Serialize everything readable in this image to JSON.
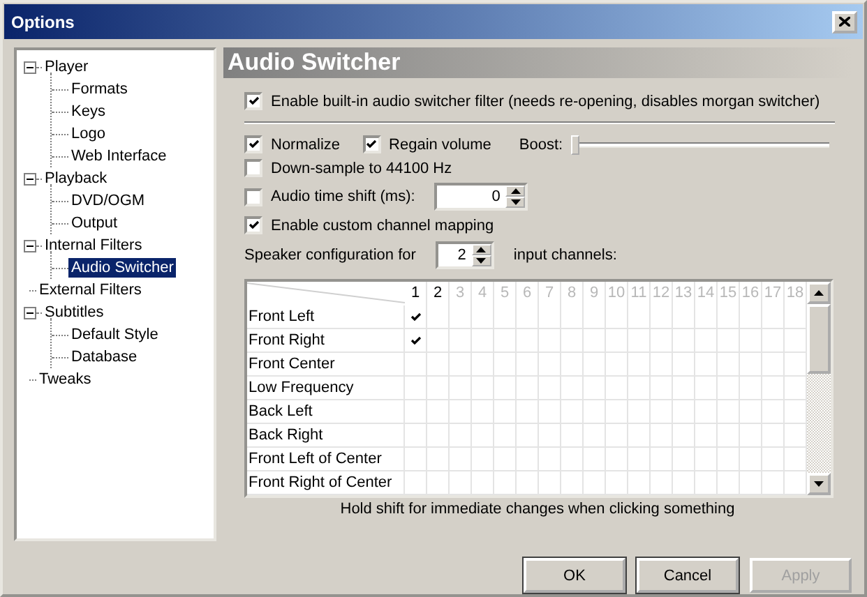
{
  "window": {
    "title": "Options"
  },
  "tree": [
    {
      "label": "Player",
      "expanded": true,
      "selected": false,
      "children": [
        {
          "label": "Formats",
          "selected": false
        },
        {
          "label": "Keys",
          "selected": false
        },
        {
          "label": "Logo",
          "selected": false
        },
        {
          "label": "Web Interface",
          "selected": false
        }
      ]
    },
    {
      "label": "Playback",
      "expanded": true,
      "selected": false,
      "children": [
        {
          "label": "DVD/OGM",
          "selected": false
        },
        {
          "label": "Output",
          "selected": false
        }
      ]
    },
    {
      "label": "Internal Filters",
      "expanded": true,
      "selected": false,
      "children": [
        {
          "label": "Audio Switcher",
          "selected": true
        }
      ]
    },
    {
      "label": "External Filters",
      "selected": false
    },
    {
      "label": "Subtitles",
      "expanded": true,
      "selected": false,
      "children": [
        {
          "label": "Default Style",
          "selected": false
        },
        {
          "label": "Database",
          "selected": false
        }
      ]
    },
    {
      "label": "Tweaks",
      "selected": false
    }
  ],
  "page": {
    "title": "Audio Switcher",
    "enable_filter": {
      "label": "Enable built-in audio switcher filter (needs re-opening, disables morgan switcher)",
      "checked": true
    },
    "normalize": {
      "label": "Normalize",
      "checked": true
    },
    "regain_volume": {
      "label": "Regain volume",
      "checked": true
    },
    "boost": {
      "label": "Boost:",
      "level": 0
    },
    "down_sample": {
      "label": "Down-sample to 44100 Hz",
      "checked": false
    },
    "time_shift": {
      "label": "Audio time shift (ms):",
      "checked": false,
      "value": "0"
    },
    "custom_mapping": {
      "label": "Enable custom channel mapping",
      "checked": true
    },
    "speaker_config": {
      "label_before": "Speaker configuration for",
      "value": "2",
      "label_after": "input channels:"
    },
    "grid": {
      "columns": [
        {
          "label": "1",
          "enabled": true
        },
        {
          "label": "2",
          "enabled": true
        },
        {
          "label": "3",
          "enabled": false
        },
        {
          "label": "4",
          "enabled": false
        },
        {
          "label": "5",
          "enabled": false
        },
        {
          "label": "6",
          "enabled": false
        },
        {
          "label": "7",
          "enabled": false
        },
        {
          "label": "8",
          "enabled": false
        },
        {
          "label": "9",
          "enabled": false
        },
        {
          "label": "10",
          "enabled": false
        },
        {
          "label": "11",
          "enabled": false
        },
        {
          "label": "12",
          "enabled": false
        },
        {
          "label": "13",
          "enabled": false
        },
        {
          "label": "14",
          "enabled": false
        },
        {
          "label": "15",
          "enabled": false
        },
        {
          "label": "16",
          "enabled": false
        },
        {
          "label": "17",
          "enabled": false
        },
        {
          "label": "18",
          "enabled": false
        }
      ],
      "rows": [
        {
          "name": "Front Left",
          "cells": [
            true,
            false,
            false,
            false,
            false,
            false,
            false,
            false,
            false,
            false,
            false,
            false,
            false,
            false,
            false,
            false,
            false,
            false
          ]
        },
        {
          "name": "Front Right",
          "cells": [
            true,
            false,
            false,
            false,
            false,
            false,
            false,
            false,
            false,
            false,
            false,
            false,
            false,
            false,
            false,
            false,
            false,
            false
          ]
        },
        {
          "name": "Front Center",
          "cells": [
            false,
            false,
            false,
            false,
            false,
            false,
            false,
            false,
            false,
            false,
            false,
            false,
            false,
            false,
            false,
            false,
            false,
            false
          ]
        },
        {
          "name": "Low Frequency",
          "cells": [
            false,
            false,
            false,
            false,
            false,
            false,
            false,
            false,
            false,
            false,
            false,
            false,
            false,
            false,
            false,
            false,
            false,
            false
          ]
        },
        {
          "name": "Back Left",
          "cells": [
            false,
            false,
            false,
            false,
            false,
            false,
            false,
            false,
            false,
            false,
            false,
            false,
            false,
            false,
            false,
            false,
            false,
            false
          ]
        },
        {
          "name": "Back Right",
          "cells": [
            false,
            false,
            false,
            false,
            false,
            false,
            false,
            false,
            false,
            false,
            false,
            false,
            false,
            false,
            false,
            false,
            false,
            false
          ]
        },
        {
          "name": "Front Left of Center",
          "cells": [
            false,
            false,
            false,
            false,
            false,
            false,
            false,
            false,
            false,
            false,
            false,
            false,
            false,
            false,
            false,
            false,
            false,
            false
          ]
        },
        {
          "name": "Front Right of Center",
          "cells": [
            false,
            false,
            false,
            false,
            false,
            false,
            false,
            false,
            false,
            false,
            false,
            false,
            false,
            false,
            false,
            false,
            false,
            false
          ]
        }
      ]
    },
    "hint": "Hold shift for immediate changes when clicking something"
  },
  "buttons": [
    {
      "label": "OK",
      "disabled": false
    },
    {
      "label": "Cancel",
      "disabled": false
    },
    {
      "label": "Apply",
      "disabled": true
    }
  ]
}
